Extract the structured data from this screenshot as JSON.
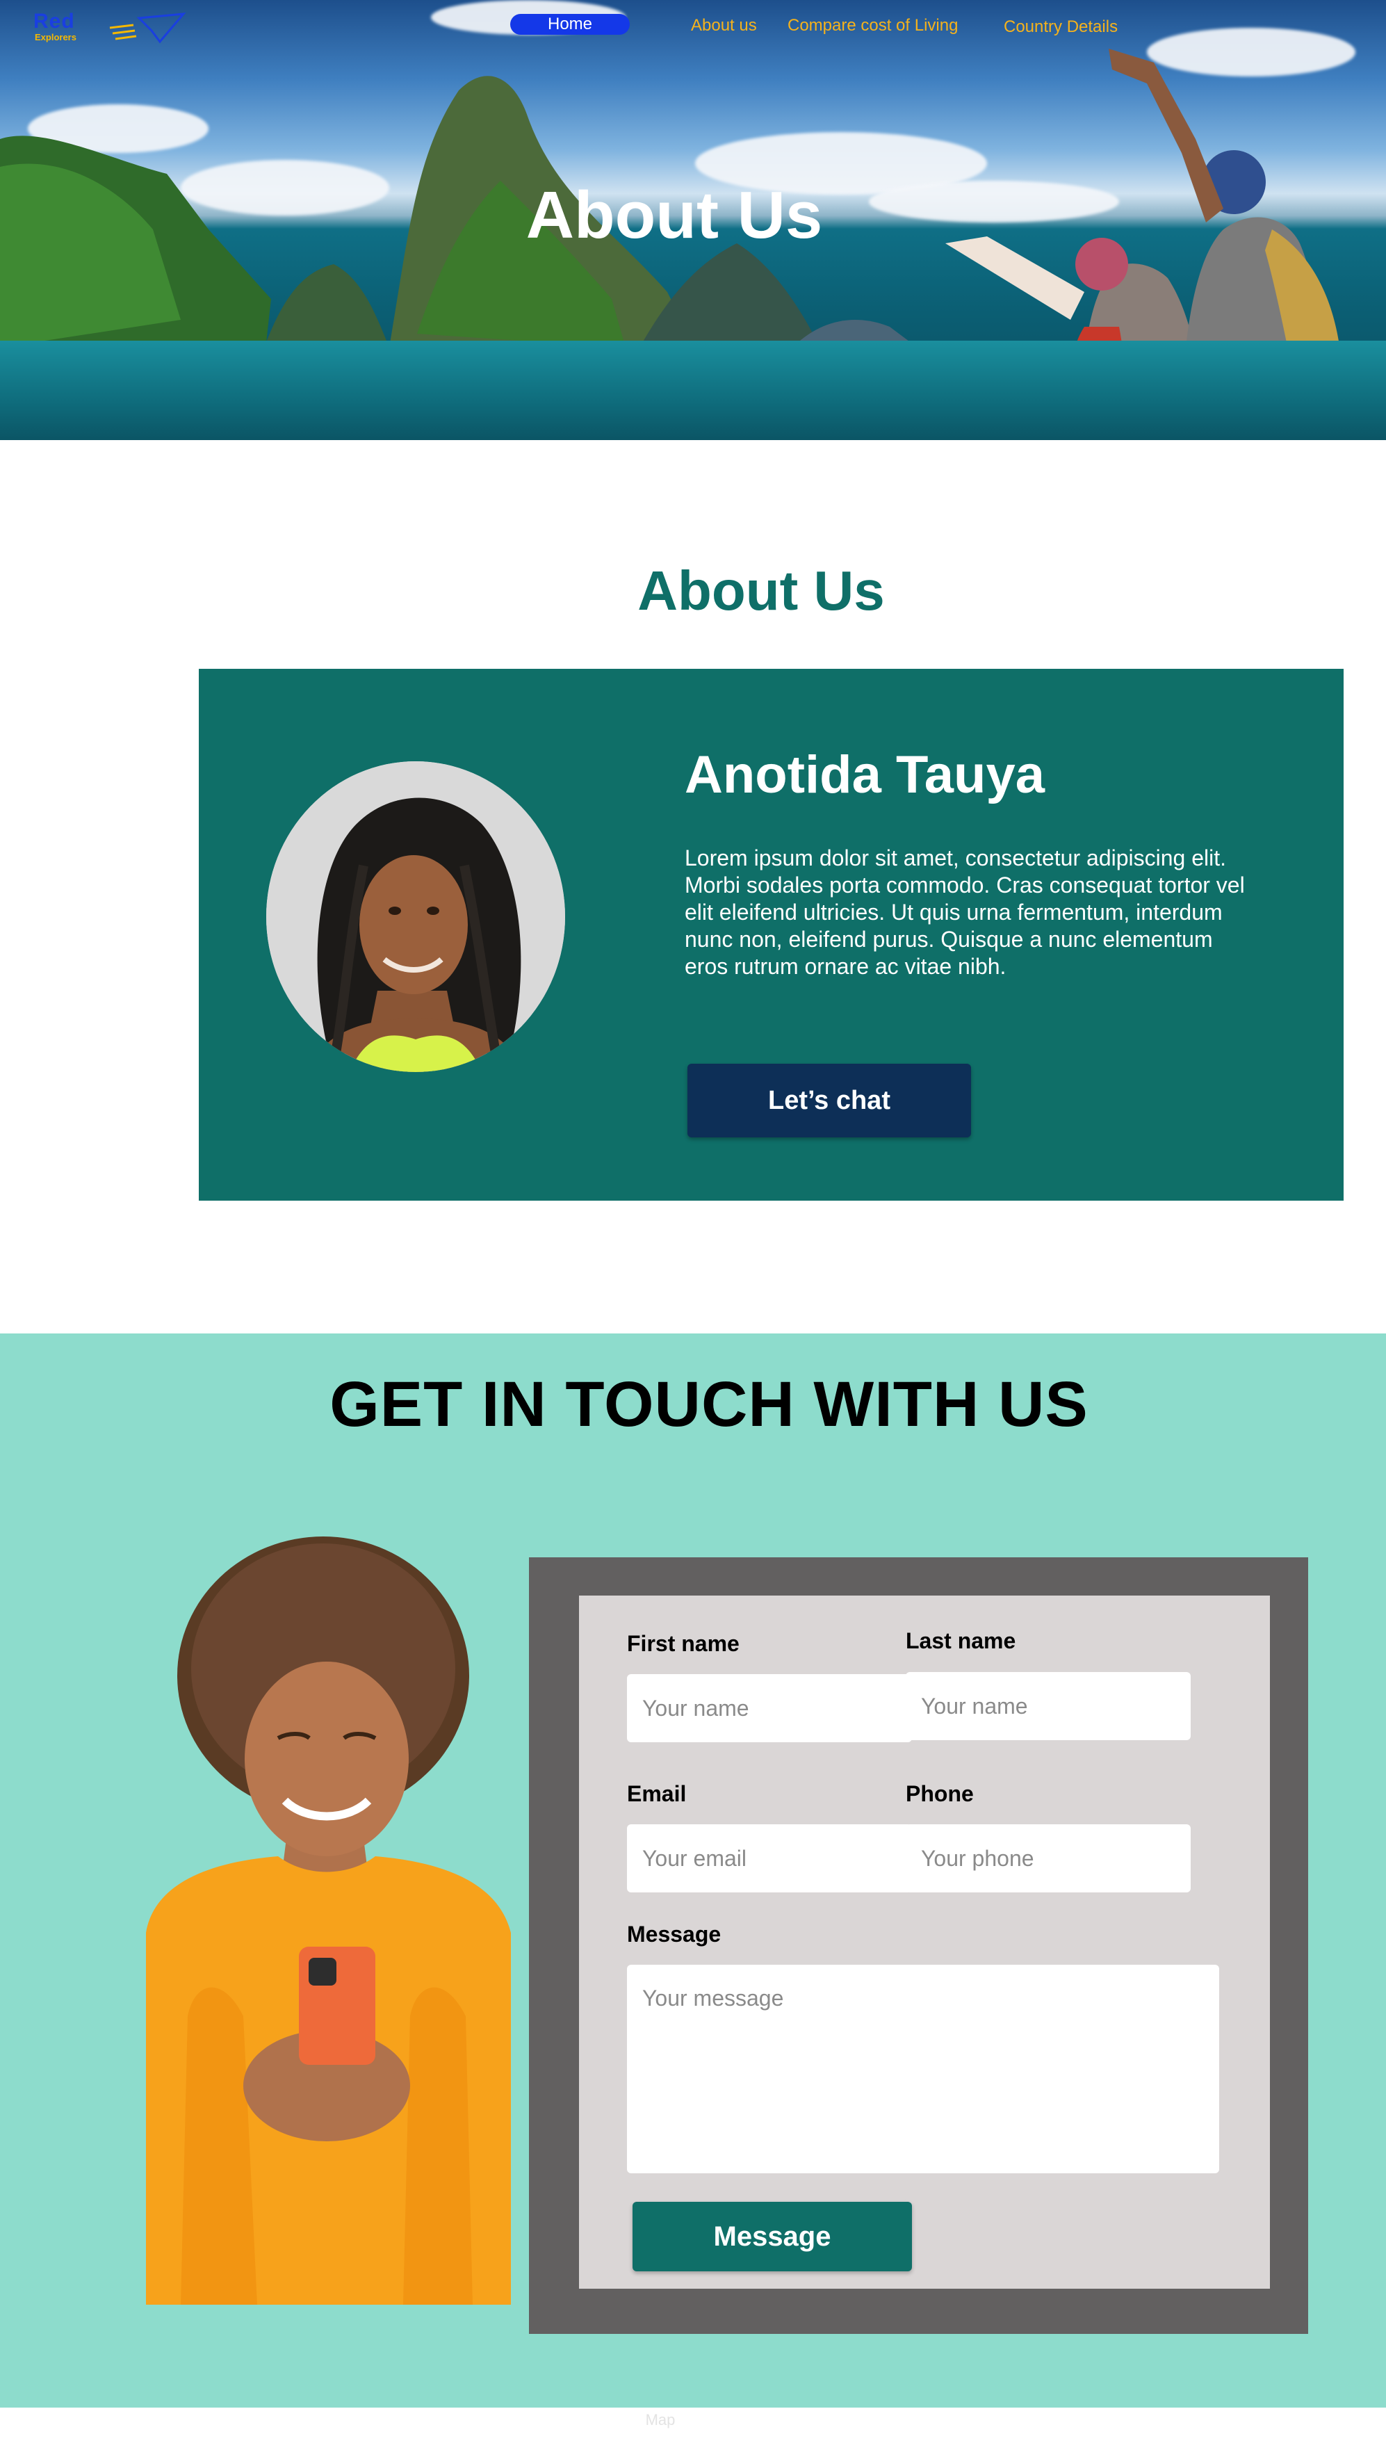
{
  "header": {
    "logo": {
      "word": "Red",
      "sub": "Explorers"
    },
    "nav": [
      {
        "label": "Home",
        "active": true
      },
      {
        "label": "About us"
      },
      {
        "label": "Compare cost of Living"
      },
      {
        "label": "Country Details"
      }
    ]
  },
  "hero": {
    "title": "About Us"
  },
  "about": {
    "heading": "About Us",
    "person_name": "Anotida Tauya",
    "bio": "Lorem ipsum dolor sit amet, consectetur adipiscing elit. Morbi sodales porta commodo. Cras consequat tortor vel elit eleifend ultricies. Ut quis urna fermentum, interdum nunc non, eleifend purus. Quisque a nunc elementum eros rutrum ornare ac vitae nibh.",
    "cta_label": "Let’s chat"
  },
  "contact": {
    "heading": "GET IN TOUCH WITH US",
    "form": {
      "first_name_label": "First name",
      "first_name_placeholder": "Your name",
      "last_name_label": "Last name",
      "last_name_placeholder": "Your name",
      "email_label": "Email",
      "email_placeholder": "Your email",
      "phone_label": "Phone",
      "phone_placeholder": "Your phone",
      "message_label": "Message",
      "message_placeholder": "Your message",
      "submit_label": "Message"
    }
  },
  "footer": {
    "map_label": "Map"
  },
  "colors": {
    "teal": "#0f6f68",
    "mint": "#8ddccc",
    "navy_button": "#0d2f57",
    "nav_link": "#f5b21c",
    "nav_active": "#1438e8"
  }
}
